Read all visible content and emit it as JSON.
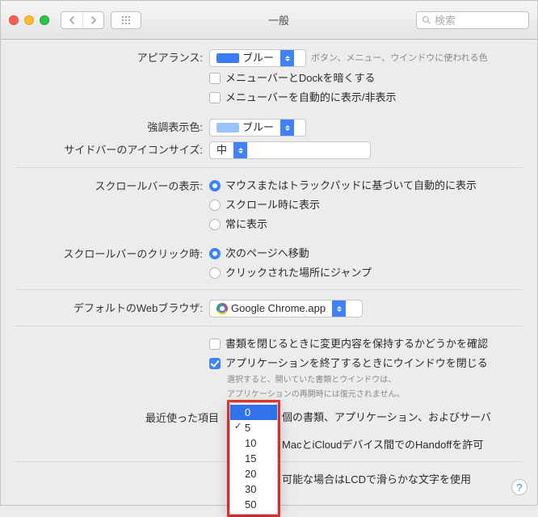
{
  "window": {
    "title": "一般"
  },
  "search": {
    "placeholder": "検索"
  },
  "appearance": {
    "label": "アピアランス:",
    "value": "ブルー",
    "suffix": "ボタン、メニュー、ウインドウに使われる色",
    "opt_darken": "メニューバーとDockを暗くする",
    "opt_autohide": "メニューバーを自動的に表示/非表示"
  },
  "highlight": {
    "label": "強調表示色:",
    "value": "ブルー"
  },
  "sidebar_icon": {
    "label": "サイドバーのアイコンサイズ:",
    "value": "中"
  },
  "scrollbar_show": {
    "label": "スクロールバーの表示:",
    "opt_auto": "マウスまたはトラックパッドに基づいて自動的に表示",
    "opt_when": "スクロール時に表示",
    "opt_always": "常に表示"
  },
  "scrollbar_click": {
    "label": "スクロールバーのクリック時:",
    "opt_page": "次のページへ移動",
    "opt_jump": "クリックされた場所にジャンプ"
  },
  "browser": {
    "label": "デフォルトのWebブラウザ:",
    "value": "Google Chrome.app"
  },
  "docs": {
    "opt_confirm": "書類を閉じるときに変更内容を保持するかどうかを確認",
    "opt_close_win": "アプリケーションを終了するときにウインドウを閉じる",
    "help1": "選択すると、開いていた書類とウインドウは、",
    "help2": "アプリケーションの再開時には復元されません。"
  },
  "recent": {
    "label": "最近使った項目",
    "suffix": "個の書類、アプリケーション、およびサーバ",
    "options": [
      "0",
      "5",
      "10",
      "15",
      "20",
      "30",
      "50"
    ],
    "selected": "0",
    "checked": "5"
  },
  "handoff": {
    "text": "MacとiCloudデバイス間でのHandoffを許可"
  },
  "lcd": {
    "text": "可能な場合はLCDで滑らかな文字を使用"
  }
}
